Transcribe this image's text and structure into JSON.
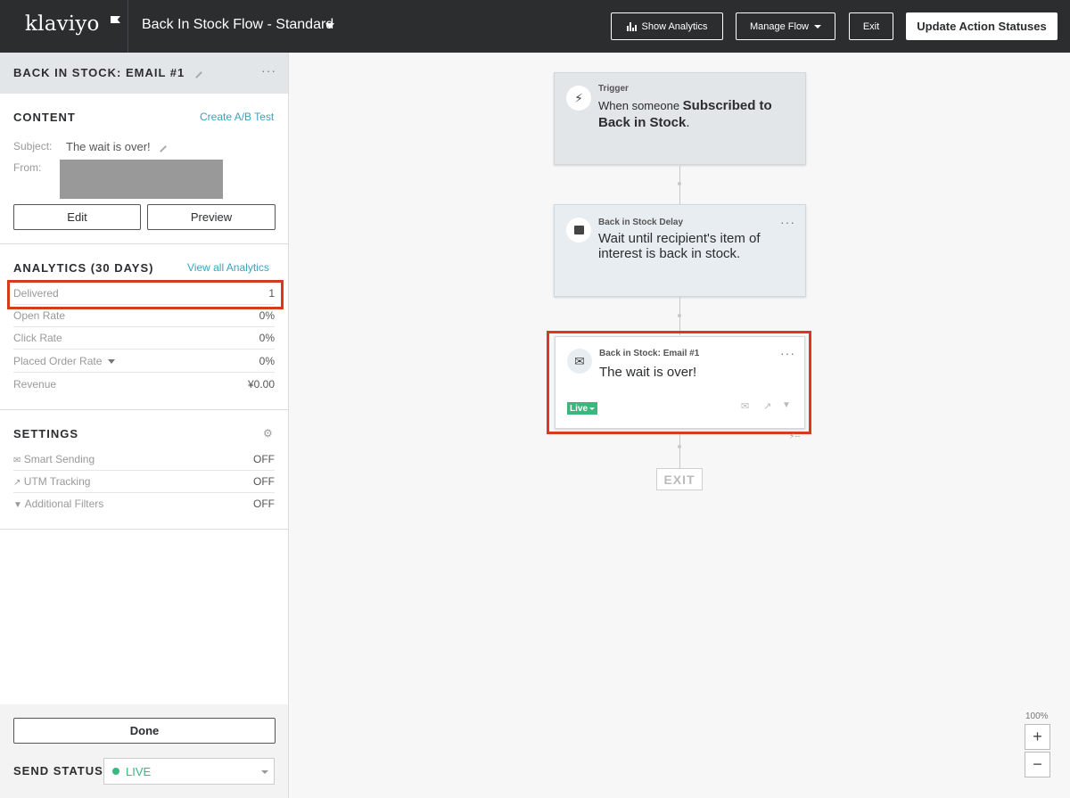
{
  "brand": {
    "logo_text": "klaviyo",
    "accent": "#3aa3b9",
    "live_color": "#3bb77e",
    "highlight_color": "#d73b1f"
  },
  "topbar": {
    "flow_title": "Back In Stock Flow - Standard",
    "show_analytics": "Show Analytics",
    "manage_flow": "Manage Flow",
    "exit": "Exit",
    "update_statuses": "Update Action Statuses"
  },
  "sidebar": {
    "title": "BACK IN STOCK: EMAIL #1",
    "content": {
      "heading": "CONTENT",
      "ab_test": "Create A/B Test",
      "subject_label": "Subject:",
      "subject_value": "The wait is over!",
      "from_label": "From:",
      "edit": "Edit",
      "preview": "Preview"
    },
    "analytics": {
      "heading": "ANALYTICS (30 DAYS)",
      "view_all": "View all Analytics",
      "rows": [
        {
          "label": "Delivered",
          "value": "1"
        },
        {
          "label": "Open Rate",
          "value": "0%"
        },
        {
          "label": "Click Rate",
          "value": "0%"
        },
        {
          "label": "Placed Order Rate",
          "value": "0%"
        },
        {
          "label": "Revenue",
          "value": "¥0.00"
        }
      ]
    },
    "settings": {
      "heading": "SETTINGS",
      "rows": [
        {
          "label": "Smart Sending",
          "value": "OFF",
          "icon": "smart-sending-icon"
        },
        {
          "label": "UTM Tracking",
          "value": "OFF",
          "icon": "utm-tracking-icon"
        },
        {
          "label": "Additional Filters",
          "value": "OFF",
          "icon": "filter-icon"
        }
      ]
    },
    "done": "Done",
    "send_status_label": "SEND STATUS",
    "send_status_value": "LIVE"
  },
  "canvas": {
    "trigger": {
      "kicker": "Trigger",
      "text_pre": "When someone ",
      "text_bold": "Subscribed to Back in Stock",
      "text_post": "."
    },
    "delay": {
      "kicker": "Back in Stock Delay",
      "text": "Wait until recipient's item of interest is back in stock."
    },
    "email": {
      "kicker": "Back in Stock: Email #1",
      "text": "The wait is over!",
      "status": "Live",
      "conversion_marker": "--"
    },
    "exit": "EXIT",
    "zoom": "100%",
    "zoom_in": "+",
    "zoom_out": "−"
  }
}
